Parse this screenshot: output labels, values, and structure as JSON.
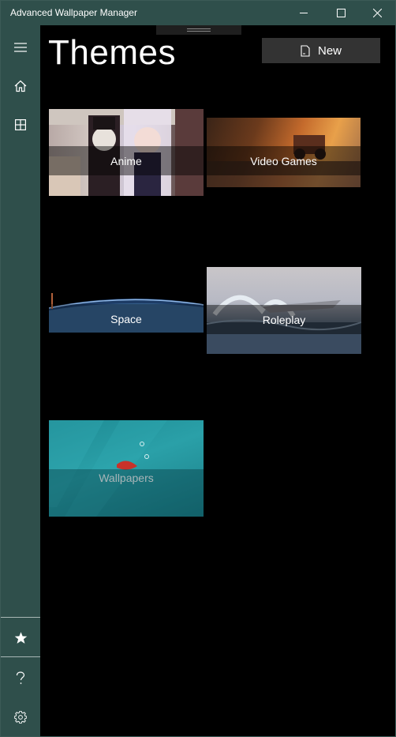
{
  "window": {
    "title": "Advanced Wallpaper Manager",
    "controls": {
      "minimize": "minimize-icon",
      "maximize": "maximize-icon",
      "close": "close-icon"
    }
  },
  "sidebar": {
    "items": [
      {
        "name": "hamburger-menu",
        "icon": "menu-icon"
      },
      {
        "name": "home",
        "icon": "home-icon"
      },
      {
        "name": "gallery",
        "icon": "grid-icon"
      },
      {
        "name": "favorites",
        "icon": "star-icon"
      },
      {
        "name": "help",
        "icon": "help-icon"
      },
      {
        "name": "settings",
        "icon": "gear-icon"
      }
    ]
  },
  "page": {
    "title": "Themes"
  },
  "toolbar": {
    "new_label": "New",
    "new_icon": "page-icon"
  },
  "themes": [
    {
      "label": "Anime"
    },
    {
      "label": "Video Games"
    },
    {
      "label": "Space"
    },
    {
      "label": "Roleplay"
    },
    {
      "label": "Wallpapers"
    }
  ],
  "colors": {
    "sidebar": "#2f4f4b",
    "background": "#000000",
    "button": "#333333"
  }
}
